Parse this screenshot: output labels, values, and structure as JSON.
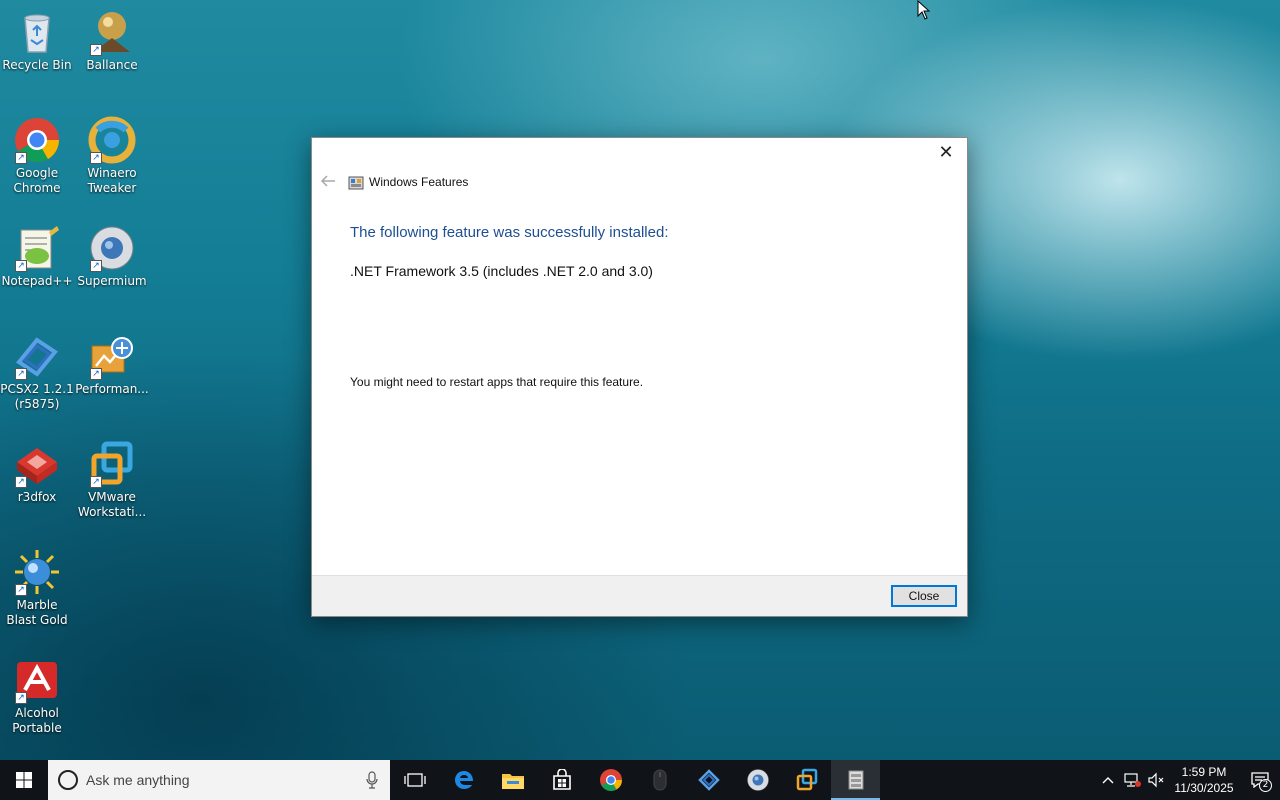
{
  "desktop": {
    "icons": [
      {
        "label": "Recycle Bin",
        "icon": "recycle-bin-icon"
      },
      {
        "label": "Ballance",
        "icon": "ballance-icon"
      },
      {
        "label": "Google Chrome",
        "icon": "chrome-icon"
      },
      {
        "label": "Winaero Tweaker",
        "icon": "winaero-tweaker-icon"
      },
      {
        "label": "Notepad++",
        "icon": "notepad-plus-plus-icon"
      },
      {
        "label": "Supermium",
        "icon": "supermium-icon"
      },
      {
        "label": "PCSX2 1.2.1 (r5875)",
        "icon": "pcsx2-icon"
      },
      {
        "label": "Performan...",
        "icon": "performance-icon"
      },
      {
        "label": "r3dfox",
        "icon": "r3dfox-icon"
      },
      {
        "label": "VMware Workstati...",
        "icon": "vmware-icon"
      },
      {
        "label": "Marble Blast Gold",
        "icon": "marble-blast-icon"
      },
      {
        "label": "Alcohol Portable",
        "icon": "alcohol-icon"
      }
    ]
  },
  "dialog": {
    "title": "Windows Features",
    "heading": "The following feature was successfully installed:",
    "feature": ".NET Framework 3.5 (includes .NET 2.0 and 3.0)",
    "note": "You might need to restart apps that require this feature.",
    "close_button": "Close",
    "close_x": "✕"
  },
  "taskbar": {
    "search_placeholder": "Ask me anything",
    "clock_time": "1:59 PM",
    "clock_date": "11/30/2025",
    "notification_count": "2",
    "pinned": [
      {
        "name": "task-view-icon"
      },
      {
        "name": "edge-icon"
      },
      {
        "name": "file-explorer-icon"
      },
      {
        "name": "store-icon"
      },
      {
        "name": "chrome-icon"
      },
      {
        "name": "mouse-icon"
      },
      {
        "name": "pcsx2-icon"
      },
      {
        "name": "supermium-icon"
      },
      {
        "name": "vmware-icon"
      },
      {
        "name": "windows-features-icon"
      }
    ]
  },
  "colors": {
    "accent": "#0078d7",
    "heading_blue": "#1d4f91",
    "taskbar": "#101418"
  }
}
